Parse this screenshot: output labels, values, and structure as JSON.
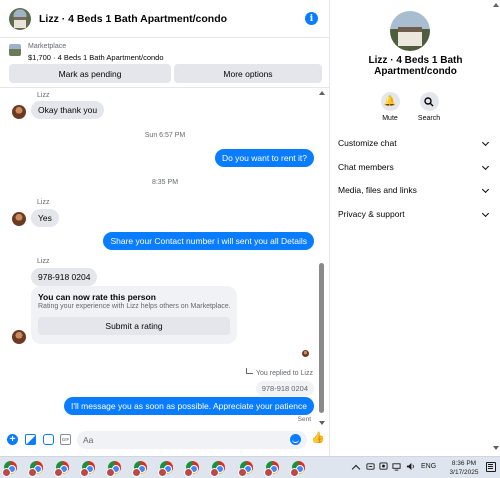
{
  "header": {
    "title": "Lizz · 4 Beds 1 Bath Apartment/condo"
  },
  "listing": {
    "source": "Marketplace",
    "info": "$1,700 · 4 Beds 1 Bath Apartment/condo",
    "mark_pending_label": "Mark as pending",
    "more_options_label": "More options"
  },
  "messages": {
    "sender_name": "Lizz",
    "msg1": "Okay thank you",
    "time1": "Sun 6:57 PM",
    "msg2": "Do you want to rent it?",
    "time2": "8:35 PM",
    "msg3": "Yes",
    "msg4": "Share your Contact number i will sent you all Details",
    "msg5": "978-918 0204",
    "rating_card": {
      "title": "You can now rate this person",
      "description": "Rating your experience with Lizz helps others on Marketplace.",
      "button_label": "Submit a rating"
    },
    "replied_to": "You replied to Lizz",
    "quoted": "978-918 0204",
    "msg6": "I'll message you as soon as possible. Appreciate your patience",
    "status": "Sent"
  },
  "composer": {
    "placeholder": "Aa",
    "gif_label": "GIF"
  },
  "info_panel": {
    "name": "Lizz · 4 Beds 1 Bath Apartment/condo",
    "mute_label": "Mute",
    "search_label": "Search",
    "sections": [
      "Customize chat",
      "Chat members",
      "Media, files and links",
      "Privacy & support"
    ]
  },
  "taskbar": {
    "language": "ENG",
    "time": "8:36 PM",
    "date": "3/17/2025",
    "app_icons": [
      "chrome-icon",
      "chrome-icon",
      "chrome-icon",
      "chrome-icon",
      "chrome-icon",
      "chrome-icon",
      "chrome-icon",
      "chrome-icon",
      "chrome-icon",
      "chrome-icon",
      "chrome-icon",
      "chrome-icon"
    ]
  },
  "colors": {
    "accent": "#0a7cff",
    "bubble_incoming": "#e4e6eb",
    "text_secondary": "#65676b",
    "taskbar": "#dfe5ee"
  }
}
